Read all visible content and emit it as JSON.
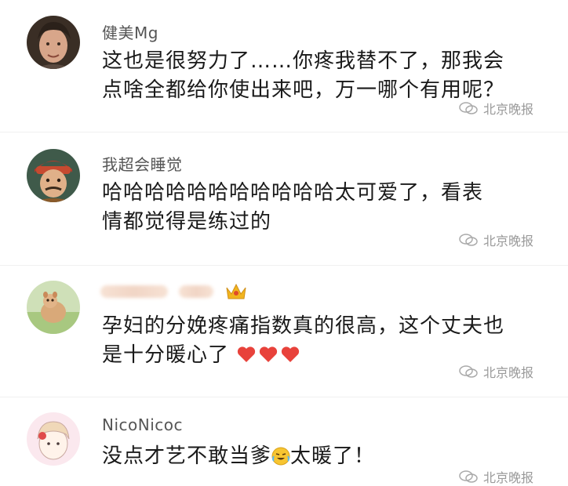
{
  "comments": [
    {
      "username": "健美Mg",
      "text_line1": "这也是很努力了……你疼我替不了，那我会",
      "text_line2": "点啥全都给你使出来吧，万一哪个有用呢？",
      "watermark": "北京晚报"
    },
    {
      "username": "我超会睡觉",
      "text_line1": "哈哈哈哈哈哈哈哈哈哈哈太可爱了，看表",
      "text_line2": "情都觉得是练过的",
      "watermark": "北京晚报"
    },
    {
      "username": "",
      "text_line1": "孕妇的分娩疼痛指数真的很高，这个丈夫也",
      "text_line2": "是十分暖心了",
      "watermark": "北京晚报"
    },
    {
      "username": "NicoNicoc",
      "text_line1_part1": "没点才艺不敢当爹",
      "text_line1_part2": "太暖了！",
      "watermark": "北京晚报"
    }
  ],
  "colors": {
    "heart": "#e8423b",
    "watermark": "#9a9a9a"
  }
}
